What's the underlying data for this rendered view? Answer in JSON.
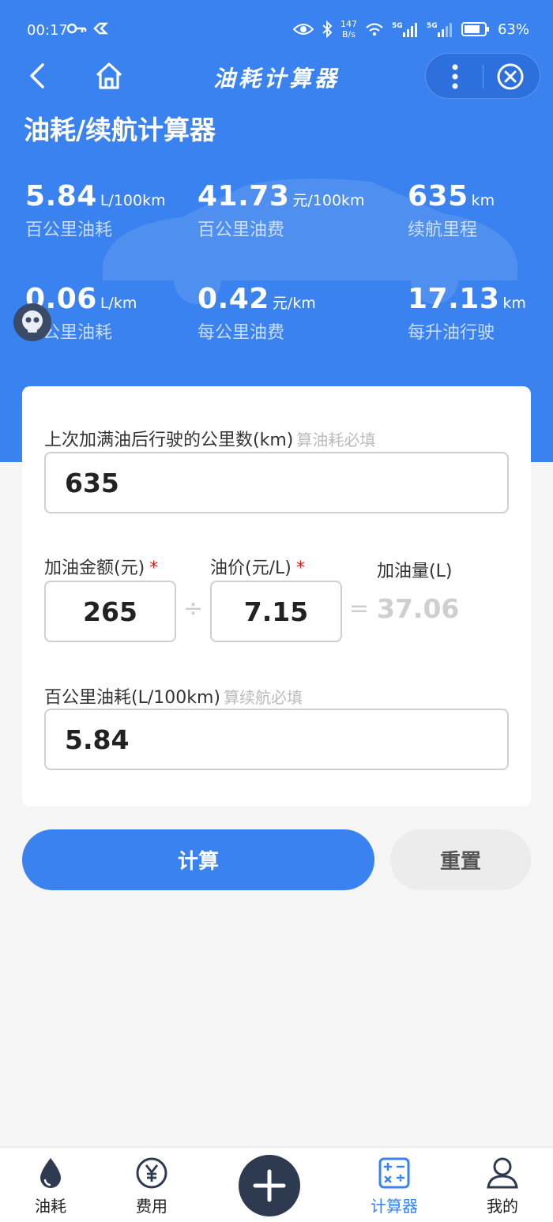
{
  "status": {
    "time": "00:17",
    "speed_value": "147",
    "speed_unit": "B/s",
    "battery": "63%",
    "signal1": "5G",
    "signal2": "5G"
  },
  "nav": {
    "title": "油耗计算器"
  },
  "page_title": "油耗/续航计算器",
  "stats": [
    {
      "value": "5.84",
      "unit": "L/100km",
      "label": "百公里油耗"
    },
    {
      "value": "41.73",
      "unit": "元/100km",
      "label": "百公里油费"
    },
    {
      "value": "635",
      "unit": "km",
      "label": "续航里程"
    },
    {
      "value": "0.06",
      "unit": "L/km",
      "label": "每公里油耗"
    },
    {
      "value": "0.42",
      "unit": "元/km",
      "label": "每公里油费"
    },
    {
      "value": "17.13",
      "unit": "km",
      "label": "每升油行驶"
    }
  ],
  "form": {
    "distance_label": "上次加满油后行驶的公里数(km)",
    "distance_hint": "算油耗必填",
    "distance_value": "635",
    "amount_label": "加油金额(元)",
    "amount_value": "265",
    "price_label": "油价(元/L)",
    "price_value": "7.15",
    "required_mark": "*",
    "divide_op": "÷",
    "equals_op": "=",
    "volume_label": "加油量(L)",
    "volume_value": "37.06",
    "consumption_label": "百公里油耗(L/100km)",
    "consumption_hint": "算续航必填",
    "consumption_value": "5.84"
  },
  "buttons": {
    "calculate": "计算",
    "reset": "重置"
  },
  "tabbar": {
    "items": [
      {
        "label": "油耗",
        "icon": "drop-icon"
      },
      {
        "label": "费用",
        "icon": "yen-icon"
      },
      {
        "label": "",
        "icon": "plus-icon"
      },
      {
        "label": "计算器",
        "icon": "calculator-icon"
      },
      {
        "label": "我的",
        "icon": "user-icon"
      }
    ]
  },
  "colors": {
    "primary": "#3a82ef",
    "background": "#f5f5f5",
    "fab": "#2d3a4f"
  }
}
